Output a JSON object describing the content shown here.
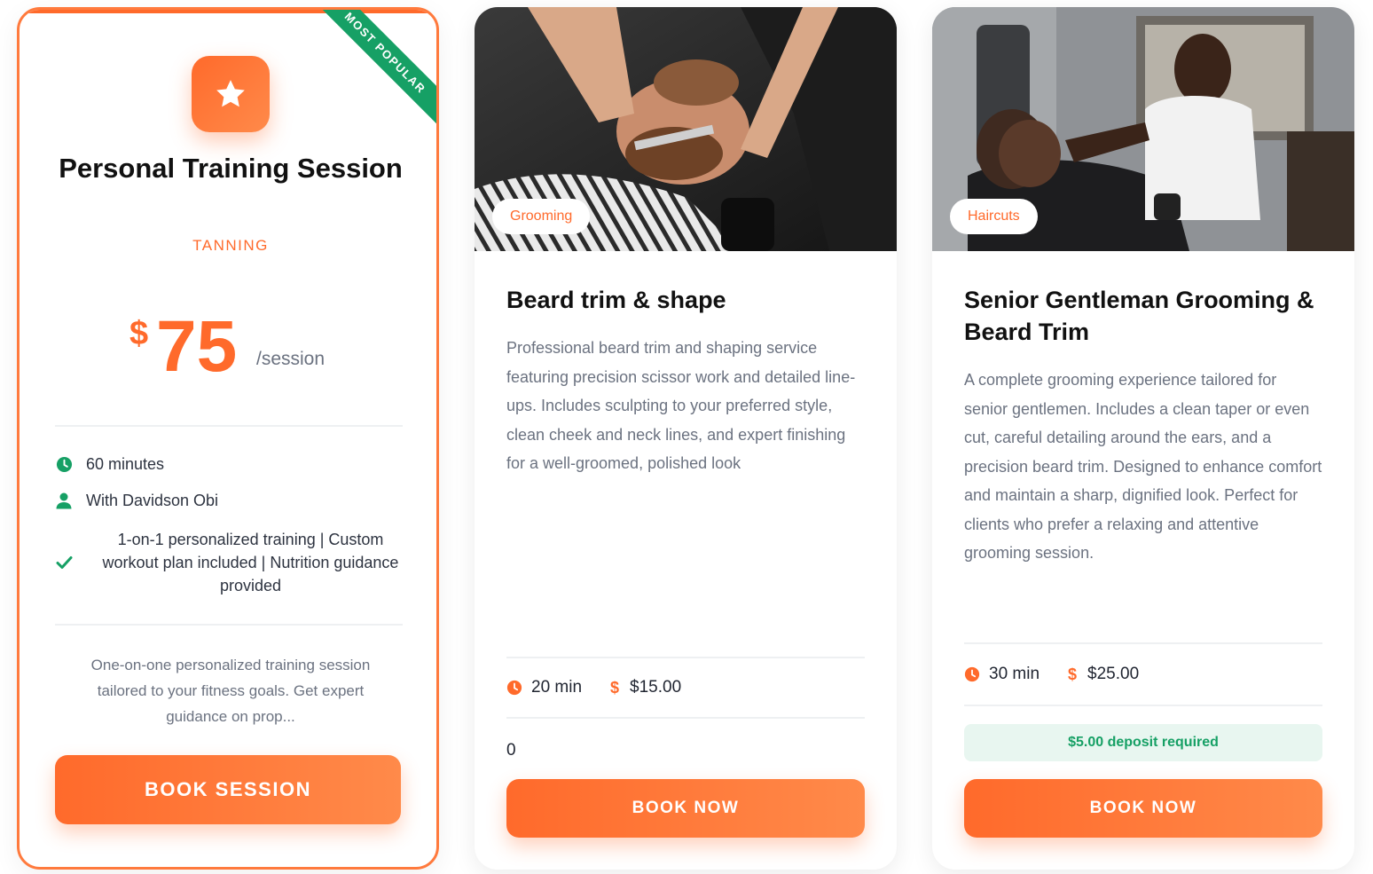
{
  "featured": {
    "ribbon": "MOST POPULAR",
    "title": "Personal Training Session",
    "category": "TANNING",
    "currency": "$",
    "price": "75",
    "per": "/session",
    "duration": "60 minutes",
    "trainer": "With Davidson Obi",
    "features": "1-on-1 personalized training | Custom workout plan included | Nutrition guidance provided",
    "description": "One-on-one personalized training session tailored to your fitness goals. Get expert guidance on prop...",
    "button": "BOOK SESSION",
    "icon": "star-icon"
  },
  "services": [
    {
      "tag": "Grooming",
      "title": "Beard trim & shape",
      "description": "Professional beard trim and shaping service featuring precision scissor work and detailed line-ups. Includes sculpting to your preferred style, clean cheek and neck lines, and expert finishing for a well-groomed, polished look",
      "duration": "20 min",
      "price": "$15.00",
      "extra": "0",
      "button": "BOOK NOW"
    },
    {
      "tag": "Haircuts",
      "title": "Senior Gentleman Grooming & Beard Trim",
      "description": "A complete grooming experience tailored for senior gentlemen. Includes a clean taper or even cut, careful detailing around the ears, and a precision beard trim. Designed to enhance comfort and maintain a sharp, dignified look. Perfect for clients who prefer a relaxing and attentive grooming session.",
      "duration": "30 min",
      "price": "$25.00",
      "deposit": "$5.00 deposit required",
      "button": "BOOK NOW"
    }
  ],
  "colors": {
    "accent": "#ff6a2b",
    "green": "#16a065",
    "muted": "#6b7280"
  }
}
